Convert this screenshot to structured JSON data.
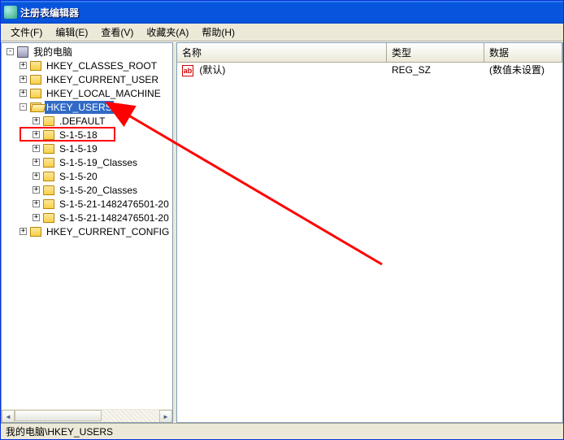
{
  "window": {
    "title": "注册表编辑器"
  },
  "menubar": {
    "file": "文件(F)",
    "edit": "编辑(E)",
    "view": "查看(V)",
    "favorites": "收藏夹(A)",
    "help": "帮助(H)"
  },
  "tree": {
    "root": "我的电脑",
    "hkcr": "HKEY_CLASSES_ROOT",
    "hkcu": "HKEY_CURRENT_USER",
    "hklm": "HKEY_LOCAL_MACHINE",
    "hku": "HKEY_USERS",
    "hku_children": {
      "default": ".DEFAULT",
      "s18": "S-1-5-18",
      "s19": "S-1-5-19",
      "s19c": "S-1-5-19_Classes",
      "s20": "S-1-5-20",
      "s20c": "S-1-5-20_Classes",
      "s21a": "S-1-5-21-1482476501-20",
      "s21b": "S-1-5-21-1482476501-20"
    },
    "hkcc": "HKEY_CURRENT_CONFIG"
  },
  "list": {
    "headers": {
      "name": "名称",
      "type": "类型",
      "data": "数据"
    },
    "row0": {
      "icon": "ab",
      "name": "(默认)",
      "type": "REG_SZ",
      "data": "(数值未设置)"
    }
  },
  "statusbar": {
    "path": "我的电脑\\HKEY_USERS"
  },
  "expanders": {
    "plus": "+",
    "minus": "-"
  }
}
